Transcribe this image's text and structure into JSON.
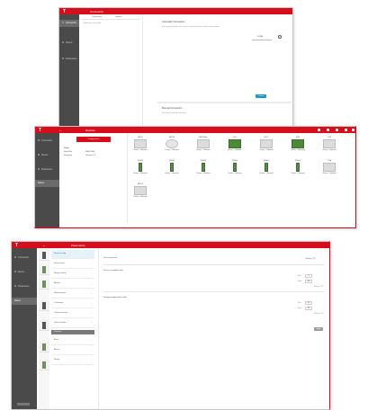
{
  "window1": {
    "tabs": [
      "Connection",
      "Options"
    ],
    "sidebar": [
      "Connection",
      "Device",
      "Parameters"
    ],
    "left_note": "Cable not connected",
    "section1_title": "Automatic Connection",
    "section1_text": "Select the device and the port to connect automatically with the controller in your computer",
    "port_value": "COM4",
    "connect_label": "Connect",
    "section2_title": "Manual Connection",
    "section2_text": "Select the port, baud rate and protocol"
  },
  "window2": {
    "title": "Devices",
    "configure_label": "Configuration",
    "info_rows": [
      {
        "k": "Model",
        "v": ""
      },
      {
        "k": "Serial No.",
        "v": "0000 0000"
      },
      {
        "k": "Firmware",
        "v": "Version 1.0"
      }
    ],
    "sidebar": [
      "Connection",
      "Device",
      "Parameters",
      "Status"
    ],
    "devices_row1": [
      {
        "name": "MDP-F",
        "cap": "Ready · Calibrated",
        "style": "gray"
      },
      {
        "name": "Mi3-TS",
        "cap": "Ready · Calibrated",
        "style": "round"
      },
      {
        "name": "MDP-Shunt",
        "cap": "Ready · Calibrated",
        "style": "gray"
      },
      {
        "name": "DI-4",
        "cap": "Ready · Calibrated",
        "style": "green"
      },
      {
        "name": "MC-2",
        "cap": "Ready · Calibrated",
        "style": "gray"
      },
      {
        "name": "MT-8",
        "cap": "Ready · Calibrated",
        "style": "green"
      },
      {
        "name": "TC-8",
        "cap": "Ready · Calibrated",
        "style": "gray"
      }
    ],
    "devices_row2": [
      {
        "name": "Pt100-1",
        "cap": "Ready · Calibrated",
        "style": "pin"
      },
      {
        "name": "Pt100-2",
        "cap": "Ready · Calibrated",
        "style": "pin"
      },
      {
        "name": "Pt100-3",
        "cap": "Ready · Calibrated",
        "style": "pin"
      },
      {
        "name": "Pt100-4",
        "cap": "Ready · Calibrated",
        "style": "pin"
      },
      {
        "name": "Pt100-5",
        "cap": "Ready · Calibrated",
        "style": "pin"
      },
      {
        "name": "Pt100-6",
        "cap": "Ready · Calibrated",
        "style": "pin"
      },
      {
        "name": "TC-A",
        "cap": "Ready · Calibrated",
        "style": "gray"
      }
    ],
    "devices_row3": [
      {
        "name": "MDP-G",
        "cap": "Ready · Calibrated",
        "style": "gray"
      }
    ]
  },
  "window3": {
    "title": "Parameters",
    "sidebar": [
      "Connection",
      "Device",
      "Parameters",
      "Status"
    ],
    "list": [
      "Device config",
      "Sensor type",
      "Range setting",
      "Alarms",
      "Measurement",
      "Calibration",
      "Communication",
      "Data recorder"
    ],
    "section_label": "Channels",
    "list2": [
      "Basic",
      "Alarm",
      "Range"
    ],
    "right_title": "Unit of measure",
    "unit_value": "Celsius (°C)",
    "group1_title": "Process variable scale",
    "group1_rows": [
      {
        "k": "Min",
        "v": "0"
      },
      {
        "k": "Max",
        "v": "100"
      }
    ],
    "group1_unit": "Range 1/2",
    "group2_title": "Storage temperature scale",
    "group2_rows": [
      {
        "k": "Min",
        "v": "-40"
      },
      {
        "k": "Max",
        "v": "85"
      }
    ],
    "group2_unit": "Range 1/2",
    "apply_label": "Apply"
  },
  "colors": {
    "brand": "#d80d1c",
    "sidebar": "#4a4a4a",
    "accent": "#1996c8"
  }
}
